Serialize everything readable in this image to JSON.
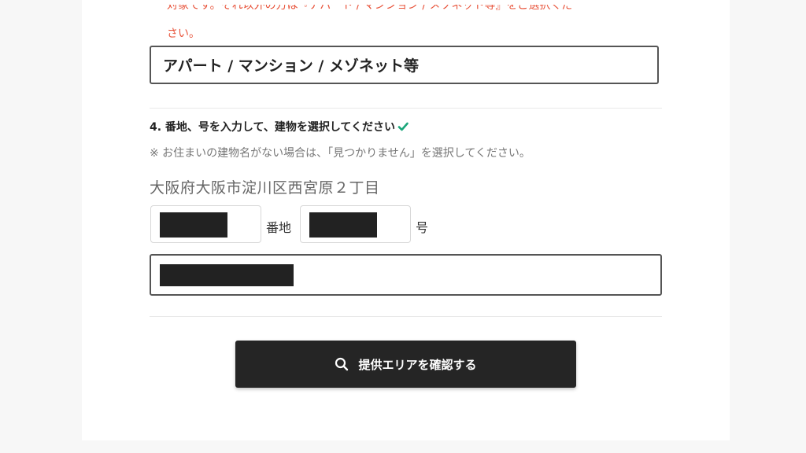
{
  "notice": {
    "line1_partial": "対象です。それ以外の方は『アパート / マンション / メゾネット等』をご選択くだ",
    "line2": "さい。"
  },
  "housing_type": {
    "selected": "アパート / マンション / メゾネット等"
  },
  "step4": {
    "title": "4. 番地、号を入力して、建物を選択してください",
    "hint": "※ お住まいの建物名がない場合は、「見つかりません」を選択してください。",
    "address": "大阪府大阪市淀川区西宮原２丁目",
    "banchi_label": "番地",
    "go_label": "号"
  },
  "confirm_button": {
    "label": "提供エリアを確認する"
  },
  "colors": {
    "notice": "#e8533a",
    "check": "#1aa67a",
    "button_bg": "#252525"
  }
}
